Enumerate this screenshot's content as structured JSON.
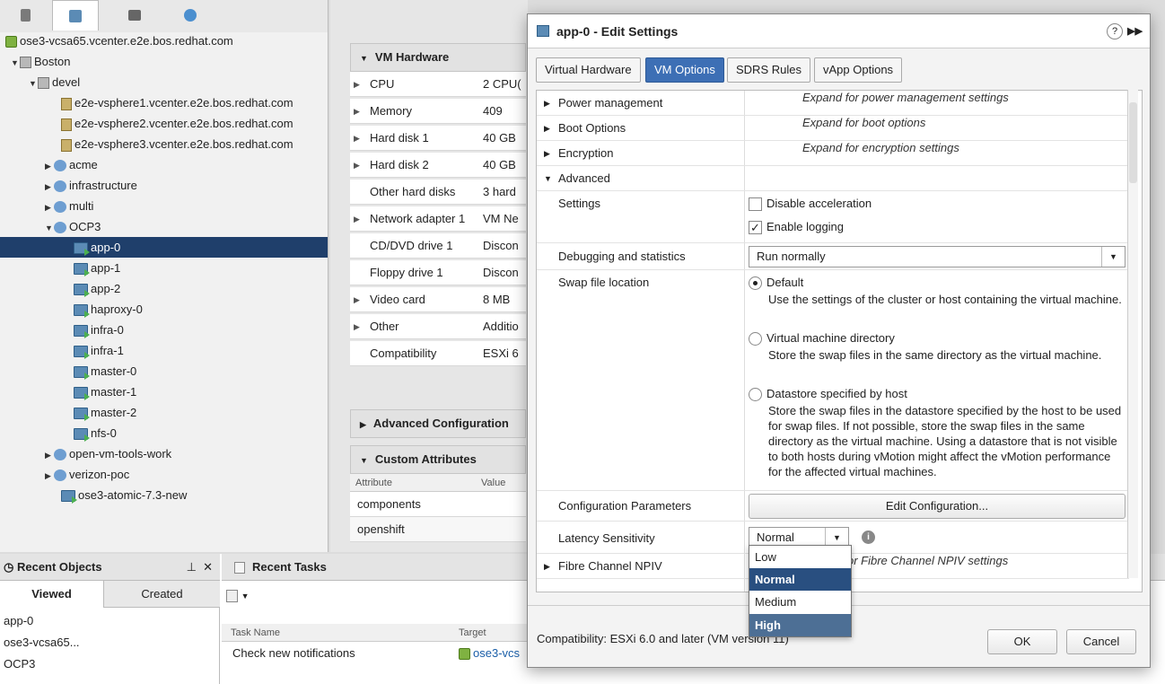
{
  "nav": {
    "vcenter": "ose3-vcsa65.vcenter.e2e.bos.redhat.com",
    "tree": [
      {
        "label": "Boston",
        "icon": "datacenter-icon",
        "level": 0,
        "caret": "▼"
      },
      {
        "label": "devel",
        "icon": "cluster-icon",
        "level": 1,
        "caret": "▼"
      },
      {
        "label": "e2e-vsphere1.vcenter.e2e.bos.redhat.com",
        "icon": "host-warning-icon",
        "level": 3,
        "caret": ""
      },
      {
        "label": "e2e-vsphere2.vcenter.e2e.bos.redhat.com",
        "icon": "host-warning-icon",
        "level": 3,
        "caret": ""
      },
      {
        "label": "e2e-vsphere3.vcenter.e2e.bos.redhat.com",
        "icon": "host-icon",
        "level": 3,
        "caret": ""
      },
      {
        "label": "acme",
        "icon": "resource-pool-icon",
        "level": 2,
        "caret": "▶"
      },
      {
        "label": "infrastructure",
        "icon": "resource-pool-icon",
        "level": 2,
        "caret": "▶"
      },
      {
        "label": "multi",
        "icon": "resource-pool-icon",
        "level": 2,
        "caret": "▶"
      },
      {
        "label": "OCP3",
        "icon": "resource-pool-icon",
        "level": 2,
        "caret": "▼"
      },
      {
        "label": "app-0",
        "icon": "vm-icon",
        "level": 4,
        "caret": "",
        "selected": true
      },
      {
        "label": "app-1",
        "icon": "vm-icon",
        "level": 4,
        "caret": ""
      },
      {
        "label": "app-2",
        "icon": "vm-icon",
        "level": 4,
        "caret": ""
      },
      {
        "label": "haproxy-0",
        "icon": "vm-icon",
        "level": 4,
        "caret": ""
      },
      {
        "label": "infra-0",
        "icon": "vm-icon",
        "level": 4,
        "caret": ""
      },
      {
        "label": "infra-1",
        "icon": "vm-icon",
        "level": 4,
        "caret": ""
      },
      {
        "label": "master-0",
        "icon": "vm-icon",
        "level": 4,
        "caret": ""
      },
      {
        "label": "master-1",
        "icon": "vm-icon",
        "level": 4,
        "caret": ""
      },
      {
        "label": "master-2",
        "icon": "vm-icon",
        "level": 4,
        "caret": ""
      },
      {
        "label": "nfs-0",
        "icon": "vm-icon",
        "level": 4,
        "caret": ""
      },
      {
        "label": "open-vm-tools-work",
        "icon": "resource-pool-icon",
        "level": 2,
        "caret": "▶"
      },
      {
        "label": "verizon-poc",
        "icon": "resource-pool-icon",
        "level": 2,
        "caret": "▶"
      },
      {
        "label": "ose3-atomic-7.3-new",
        "icon": "vm-icon",
        "level": 3,
        "caret": ""
      }
    ]
  },
  "middle": {
    "vm_hardware_title": "VM Hardware",
    "rows": [
      {
        "key": "CPU",
        "value": "2 CPU(",
        "caret": "▶"
      },
      {
        "key": "Memory",
        "value": "409",
        "caret": "▶"
      },
      {
        "key": "Hard disk 1",
        "value": "40 GB",
        "caret": "▶"
      },
      {
        "key": "Hard disk 2",
        "value": "40 GB",
        "caret": "▶"
      },
      {
        "key": "Other hard disks",
        "value": "3 hard",
        "caret": ""
      },
      {
        "key": "Network adapter 1",
        "value": "VM Ne",
        "caret": "▶"
      },
      {
        "key": "CD/DVD drive 1",
        "value": "Discon",
        "caret": ""
      },
      {
        "key": "Floppy drive 1",
        "value": "Discon",
        "caret": ""
      },
      {
        "key": "Video card",
        "value": "8 MB",
        "caret": "▶"
      },
      {
        "key": "Other",
        "value": "Additio",
        "caret": "▶"
      },
      {
        "key": "Compatibility",
        "value": "ESXi 6",
        "caret": ""
      }
    ],
    "advanced_title": "Advanced Configuration",
    "custom_title": "Custom Attributes",
    "custom_cols": [
      "Attribute",
      "Value"
    ],
    "custom_rows": [
      "components",
      "openshift"
    ]
  },
  "bottom": {
    "recent_objects": "Recent Objects",
    "viewed": "Viewed",
    "created": "Created",
    "objects": [
      "app-0",
      "ose3-vcsa65...",
      "OCP3"
    ],
    "recent_tasks": "Recent Tasks",
    "task_cols": [
      "Task Name",
      "Target"
    ],
    "task_name": "Check new notifications",
    "task_target": "ose3-vcs"
  },
  "dialog": {
    "title": "app-0 - Edit Settings",
    "tabs": [
      "Virtual Hardware",
      "VM Options",
      "SDRS Rules",
      "vApp Options"
    ],
    "power_label": "Power management",
    "power_hint": "Expand for power management settings",
    "boot_label": "Boot Options",
    "boot_hint": "Expand for boot options",
    "enc_label": "Encryption",
    "enc_hint": "Expand for encryption settings",
    "advanced_label": "Advanced",
    "settings_label": "Settings",
    "disable_accel": "Disable acceleration",
    "enable_logging": "Enable logging",
    "debug_label": "Debugging and statistics",
    "debug_value": "Run normally",
    "swap_label": "Swap file location",
    "swap_default": "Default",
    "swap_default_desc": "Use the settings of the cluster or host containing the virtual machine.",
    "swap_vmdir": "Virtual machine directory",
    "swap_vmdir_desc": "Store the swap files in the same directory as the virtual machine.",
    "swap_ds": "Datastore specified by host",
    "swap_ds_desc": "Store the swap files in the datastore specified by the host to be used for swap files. If not possible, store the swap files in the same directory as the virtual machine. Using a datastore that is not visible to both hosts during vMotion might affect the vMotion performance for the affected virtual machines.",
    "config_label": "Configuration Parameters",
    "edit_config": "Edit Configuration...",
    "latency_label": "Latency Sensitivity",
    "latency_value": "Normal",
    "fc_label": "Fibre Channel NPIV",
    "fc_hint": "or Fibre Channel NPIV settings",
    "compat": "Compatibility: ESXi 6.0 and later (VM version 11)",
    "ok": "OK",
    "cancel": "Cancel",
    "dropdown": [
      "Low",
      "Normal",
      "Medium",
      "High"
    ]
  }
}
